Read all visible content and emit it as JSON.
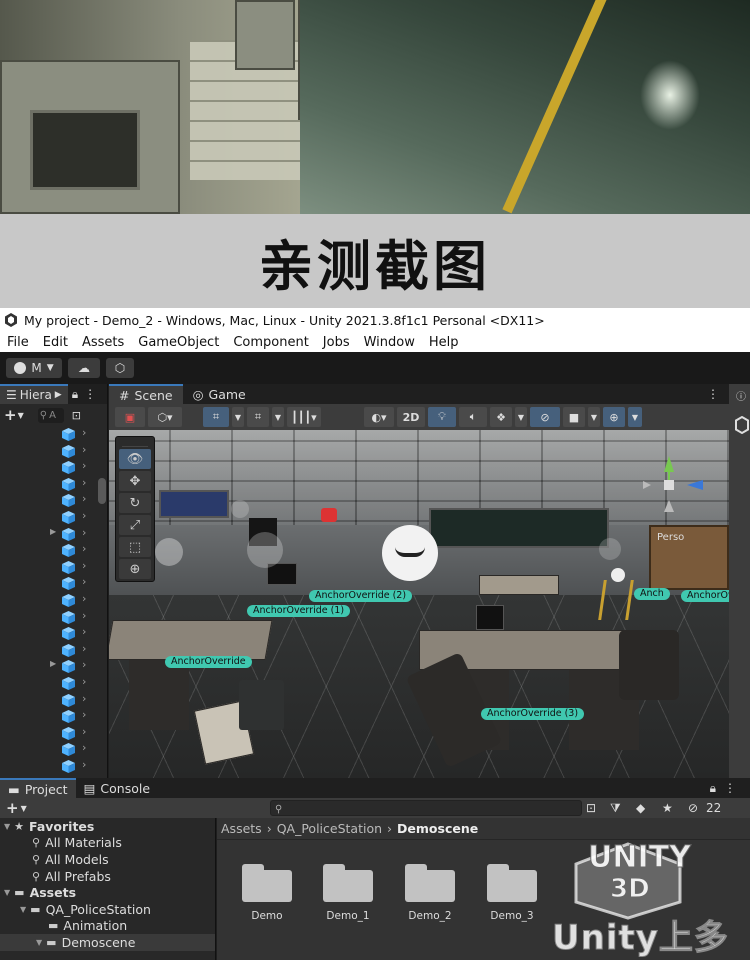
{
  "banner": {
    "title": "亲测截图"
  },
  "window": {
    "title": "My project - Demo_2 - Windows, Mac, Linux - Unity 2021.3.8f1c1 Personal <DX11>"
  },
  "menu": [
    "File",
    "Edit",
    "Assets",
    "GameObject",
    "Component",
    "Jobs",
    "Window",
    "Help"
  ],
  "toolbar": {
    "account_label": "M"
  },
  "hierarchy": {
    "tab_label": "Hiera",
    "search_placeholder": "A",
    "add_label": "+"
  },
  "scene": {
    "tabs": [
      {
        "label": "Scene",
        "icon": "grid-icon"
      },
      {
        "label": "Game",
        "icon": "gamepad-icon"
      }
    ],
    "toggle_2d_label": "2D",
    "anchor_labels": [
      "AnchorOverride (2)",
      "AnchorOverride (1)",
      "AnchorOverride",
      "AnchorOverride (3)",
      "Anch",
      "AnchorOv"
    ],
    "sign_text": "Perso"
  },
  "project": {
    "tabs": [
      {
        "label": "Project",
        "icon": "folder-icon"
      },
      {
        "label": "Console",
        "icon": "console-icon"
      }
    ],
    "add_label": "+",
    "hidden_count": "22",
    "tree": [
      {
        "label": "Favorites",
        "icon": "star-icon",
        "level": 0
      },
      {
        "label": "All Materials",
        "icon": "search-icon",
        "level": 1
      },
      {
        "label": "All Models",
        "icon": "search-icon",
        "level": 1
      },
      {
        "label": "All Prefabs",
        "icon": "search-icon",
        "level": 1
      },
      {
        "label": "Assets",
        "icon": "folder-icon",
        "level": 0
      },
      {
        "label": "QA_PoliceStation",
        "icon": "folder-icon",
        "level": 1
      },
      {
        "label": "Animation",
        "icon": "folder-icon",
        "level": 2
      },
      {
        "label": "Demoscene",
        "icon": "folder-icon",
        "level": 2
      }
    ],
    "breadcrumb": [
      "Assets",
      "QA_PoliceStation",
      "Demoscene"
    ],
    "items": [
      "Demo",
      "Demo_1",
      "Demo_2",
      "Demo_3"
    ]
  },
  "watermark": {
    "line1": "UNITY",
    "line2": "3D",
    "line3": "Unity上多"
  },
  "colors": {
    "accent": "#3a79bb",
    "anchor": "#40c8b0",
    "banner_bg": "#c8c8c8",
    "cube": "#4fb3ff"
  }
}
